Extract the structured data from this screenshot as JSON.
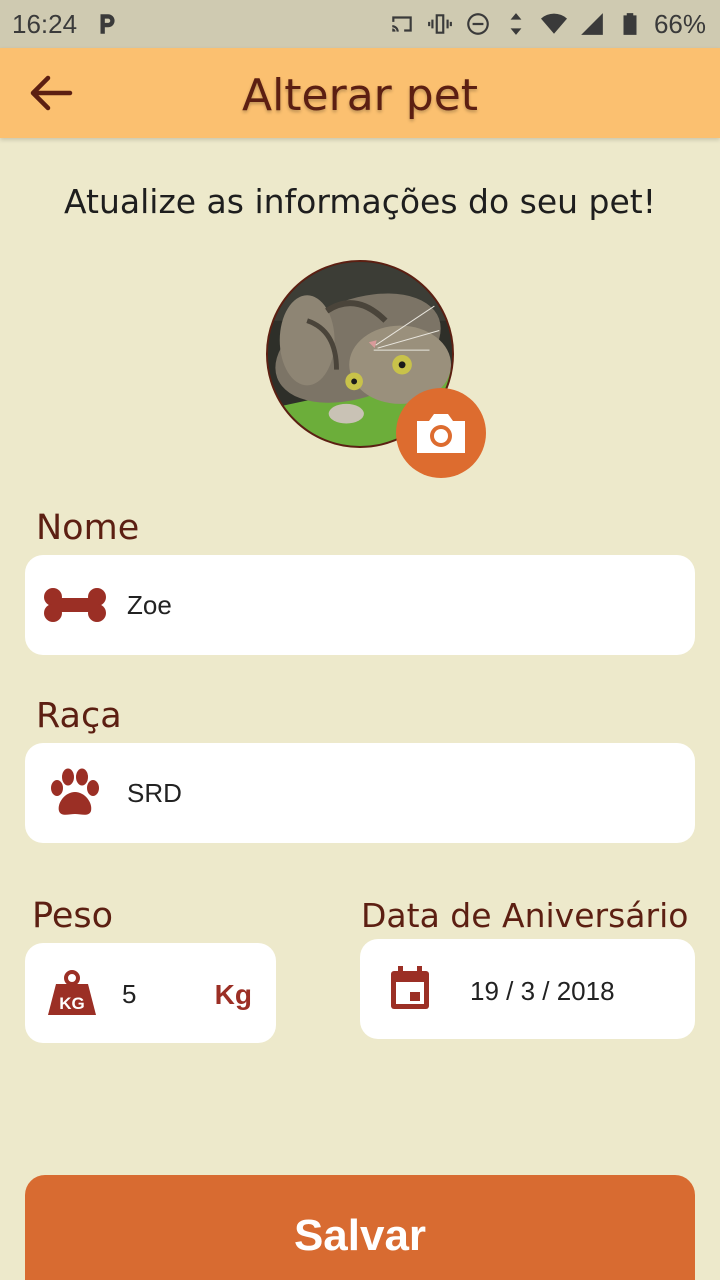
{
  "status_bar": {
    "time": "16:24",
    "battery": "66%",
    "icons": [
      "parking-app-icon",
      "cast-icon",
      "vibrate-icon",
      "do-not-disturb-icon",
      "data-arrows-icon",
      "wifi-icon",
      "signal-icon",
      "battery-icon"
    ]
  },
  "app_bar": {
    "title": "Alterar pet",
    "back_icon": "arrow-left-icon"
  },
  "subtitle": "Atualize as informações do seu pet!",
  "avatar": {
    "camera_icon": "camera-icon"
  },
  "form": {
    "name": {
      "label": "Nome",
      "value": "Zoe",
      "icon": "bone-icon"
    },
    "breed": {
      "label": "Raça",
      "value": "SRD",
      "icon": "paw-icon"
    },
    "weight": {
      "label": "Peso",
      "value": "5",
      "unit": "Kg",
      "icon": "kg-weight-icon"
    },
    "birthday": {
      "label": "Data de Aniversário",
      "value": "19 / 3 / 2018",
      "icon": "calendar-icon"
    }
  },
  "save_button": {
    "label": "Salvar"
  },
  "colors": {
    "background": "#ede9cb",
    "app_bar": "#fbc070",
    "accent": "#dd6c2f",
    "save_button": "#d86b31",
    "text_brown": "#5c1f12",
    "icon_red": "#9b2f25"
  }
}
